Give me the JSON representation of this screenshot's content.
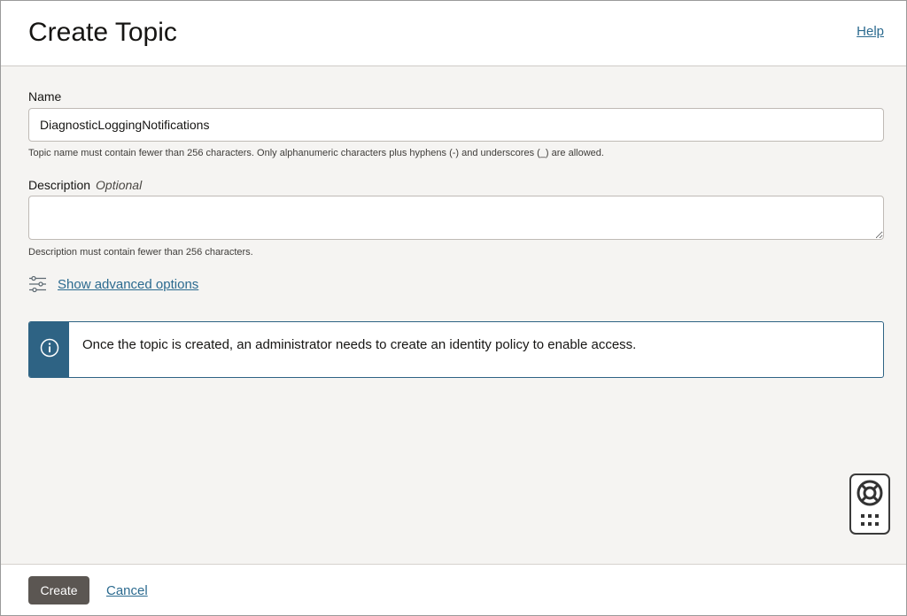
{
  "header": {
    "title": "Create Topic",
    "help_label": "Help"
  },
  "form": {
    "name": {
      "label": "Name",
      "value": "DiagnosticLoggingNotifications",
      "hint": "Topic name must contain fewer than 256 characters. Only alphanumeric characters plus hyphens (-) and underscores (_) are allowed."
    },
    "description": {
      "label": "Description",
      "optional_label": "Optional",
      "value": "",
      "hint": "Description must contain fewer than 256 characters."
    },
    "advanced": {
      "label": "Show advanced options",
      "icon": "sliders-icon"
    }
  },
  "info": {
    "icon": "info-icon",
    "text": "Once the topic is created, an administrator needs to create an identity policy to enable access.",
    "accent_color": "#2e6384"
  },
  "help_widget": {
    "icons": [
      "lifebuoy-icon",
      "grid-dots-icon"
    ]
  },
  "footer": {
    "create_label": "Create",
    "cancel_label": "Cancel"
  }
}
